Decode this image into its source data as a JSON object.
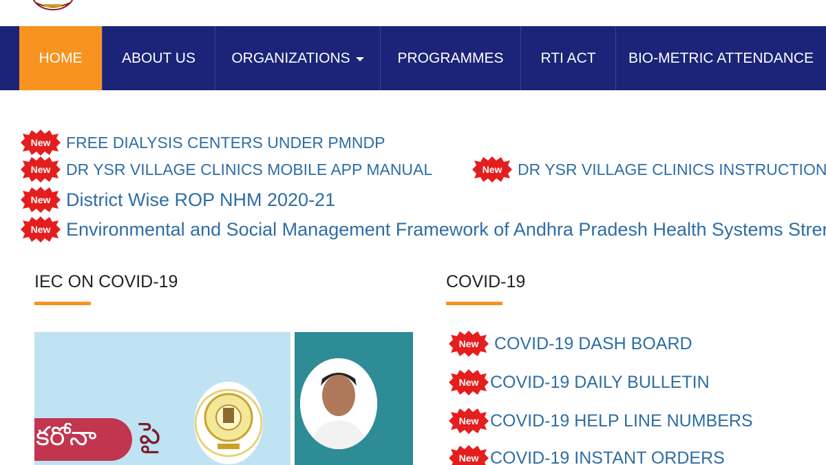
{
  "nav": {
    "items": [
      {
        "label": "HOME",
        "active": true
      },
      {
        "label": "ABOUT US",
        "active": false
      },
      {
        "label": "ORGANIZATIONS",
        "active": false,
        "dropdown": true
      },
      {
        "label": "PROGRAMMES",
        "active": false
      },
      {
        "label": "RTI ACT",
        "active": false
      },
      {
        "label": "BIO-METRIC ATTENDANCE",
        "active": false
      }
    ]
  },
  "badge_label": "New",
  "news": [
    {
      "text": "FREE DIALYSIS CENTERS UNDER PMNDP"
    },
    {
      "text": "DR YSR VILLAGE CLINICS MOBILE APP MANUAL"
    },
    {
      "text": "DR YSR VILLAGE CLINICS INSTRUCTIONS"
    },
    {
      "text": "District Wise ROP NHM 2020-21"
    },
    {
      "text": "Environmental and Social Management Framework of Andhra Pradesh Health Systems Strength"
    }
  ],
  "iec_section": {
    "title": "IEC ON COVID-19",
    "banner_pill_text": "కరోనా",
    "banner_big_text": "పై"
  },
  "covid_section": {
    "title": "COVID-19",
    "links": [
      {
        "text": " COVID-19 DASH BOARD"
      },
      {
        "text": "COVID-19 DAILY BULLETIN"
      },
      {
        "text": "COVID-19 HELP LINE NUMBERS"
      },
      {
        "text": "COVID-19 INSTANT ORDERS"
      }
    ]
  },
  "colors": {
    "nav_bg": "#1b2478",
    "active_tab": "#f7931e",
    "link": "#2e6da4",
    "badge": "#e41e1e"
  }
}
